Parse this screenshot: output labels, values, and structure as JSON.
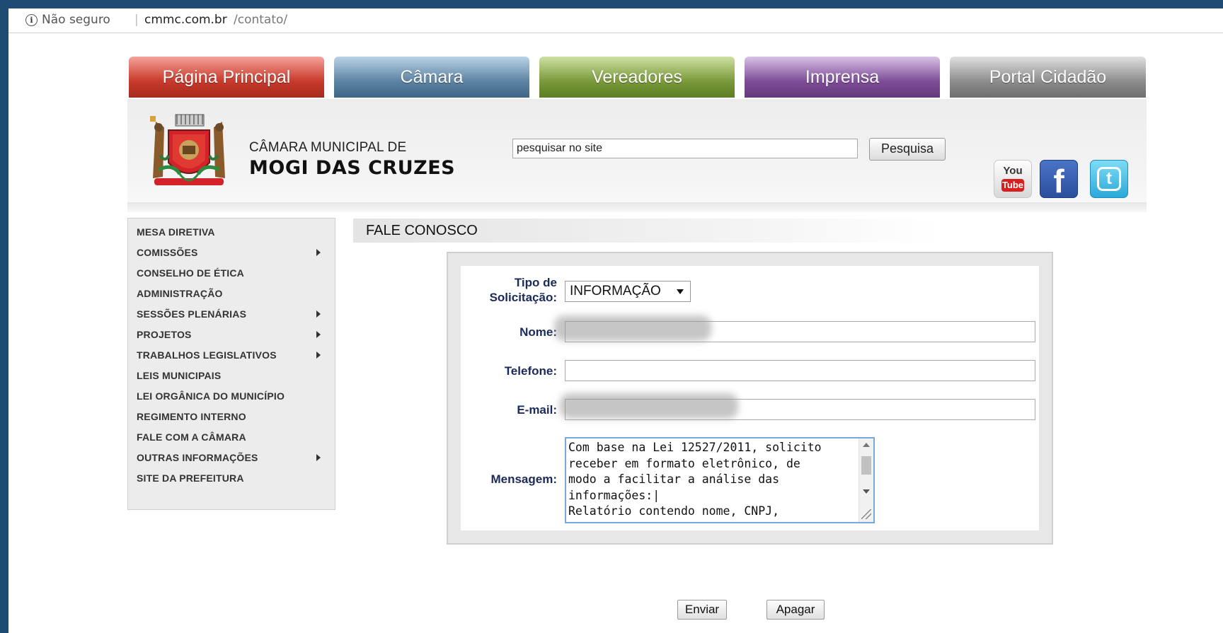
{
  "browser": {
    "security_label": "Não seguro",
    "url_domain": "cmmc.com.br",
    "url_path": "/contato/"
  },
  "nav_tabs": [
    "Página Principal",
    "Câmara",
    "Vereadores",
    "Imprensa",
    "Portal Cidadão"
  ],
  "header": {
    "line1": "CÂMARA MUNICIPAL DE",
    "line2": "MOGI DAS CRUZES",
    "search_value": "pesquisar no site",
    "search_button": "Pesquisa",
    "social_icons": [
      "youtube-icon",
      "facebook-icon",
      "twitter-icon"
    ],
    "youtube_you": "You",
    "youtube_tube": "Tube",
    "facebook_glyph": "f",
    "twitter_glyph": "t"
  },
  "sidebar": {
    "items": [
      {
        "label": "MESA DIRETIVA",
        "submenu": false
      },
      {
        "label": "COMISSÕES",
        "submenu": true
      },
      {
        "label": "CONSELHO DE ÉTICA",
        "submenu": false
      },
      {
        "label": "ADMINISTRAÇÃO",
        "submenu": false
      },
      {
        "label": "SESSÕES PLENÁRIAS",
        "submenu": true
      },
      {
        "label": "PROJETOS",
        "submenu": true
      },
      {
        "label": "TRABALHOS LEGISLATIVOS",
        "submenu": true
      },
      {
        "label": "LEIS MUNICIPAIS",
        "submenu": false
      },
      {
        "label": "LEI ORGÂNICA DO MUNICÍPIO",
        "submenu": false
      },
      {
        "label": "REGIMENTO INTERNO",
        "submenu": false
      },
      {
        "label": "FALE COM A CÂMARA",
        "submenu": false
      },
      {
        "label": "OUTRAS INFORMAÇÕES",
        "submenu": true
      },
      {
        "label": "SITE DA PREFEITURA",
        "submenu": false
      }
    ]
  },
  "page_title": "FALE CONOSCO",
  "form": {
    "tipo_label_1": "Tipo de",
    "tipo_label_2": "Solicitação:",
    "tipo_value": "INFORMAÇÃO",
    "nome_label": "Nome:",
    "telefone_label": "Telefone:",
    "email_label": "E-mail:",
    "mensagem_label": "Mensagem:",
    "mensagem_value": "Com base na Lei 12527/2011, solicito\nreceber em formato eletrônico, de\nmodo a facilitar a análise das\ninformações:|\nRelatório contendo nome, CNPJ,",
    "submit_label": "Enviar",
    "reset_label": "Apagar"
  },
  "colors": {
    "tab_principal": "#c83a2c",
    "tab_camara": "#5d83a3",
    "tab_vereadores": "#7a9a3b",
    "tab_imprensa": "#7d4d97",
    "tab_portal": "#8d8d8d",
    "label_text": "#1a2a5a"
  }
}
